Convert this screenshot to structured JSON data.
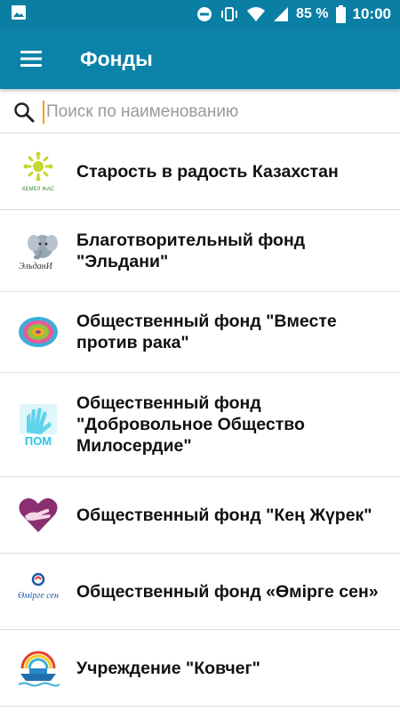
{
  "status_bar": {
    "battery": "85 %",
    "time": "10:00",
    "icons": [
      "image-notification-icon",
      "do-not-disturb-icon",
      "vibrate-icon",
      "wifi-icon",
      "signal-icon",
      "battery-icon"
    ]
  },
  "app_bar": {
    "title": "Фонды",
    "menu_icon": "hamburger-menu-icon"
  },
  "search": {
    "placeholder": "Поиск по наименованию",
    "value": "",
    "icon": "search-icon"
  },
  "funds": [
    {
      "name": "Старость в радость Казахстан",
      "logo": "kemel-zhas-logo",
      "logo_text": "КЕМЕЛ ЖАС"
    },
    {
      "name": "Благотворительный фонд\n\"Эльдани\"",
      "logo": "eldani-elephant-logo",
      "logo_text": "ЭльданИ"
    },
    {
      "name": "Общественный фонд \"Вместе\nпротив рака\"",
      "logo": "together-against-cancer-logo"
    },
    {
      "name": "Общественный фонд\n\"Добровольное Общество\nМилосердие\"",
      "logo": "miloserdie-hand-logo",
      "logo_text": "ПОМ"
    },
    {
      "name": "Общественный фонд \"Кең Жүрек\"",
      "logo": "ken-zhurek-heart-logo"
    },
    {
      "name": "Общественный  фонд «Өмірге сен»",
      "logo": "omirge-sen-logo",
      "logo_text": "Өмірге сен"
    },
    {
      "name": "Учреждение \"Ковчег\"",
      "logo": "kovcheg-ark-logo"
    }
  ],
  "colors": {
    "status_bar": "#0a7fa3",
    "app_bar": "#0b82a8",
    "caret": "#f0a000"
  }
}
